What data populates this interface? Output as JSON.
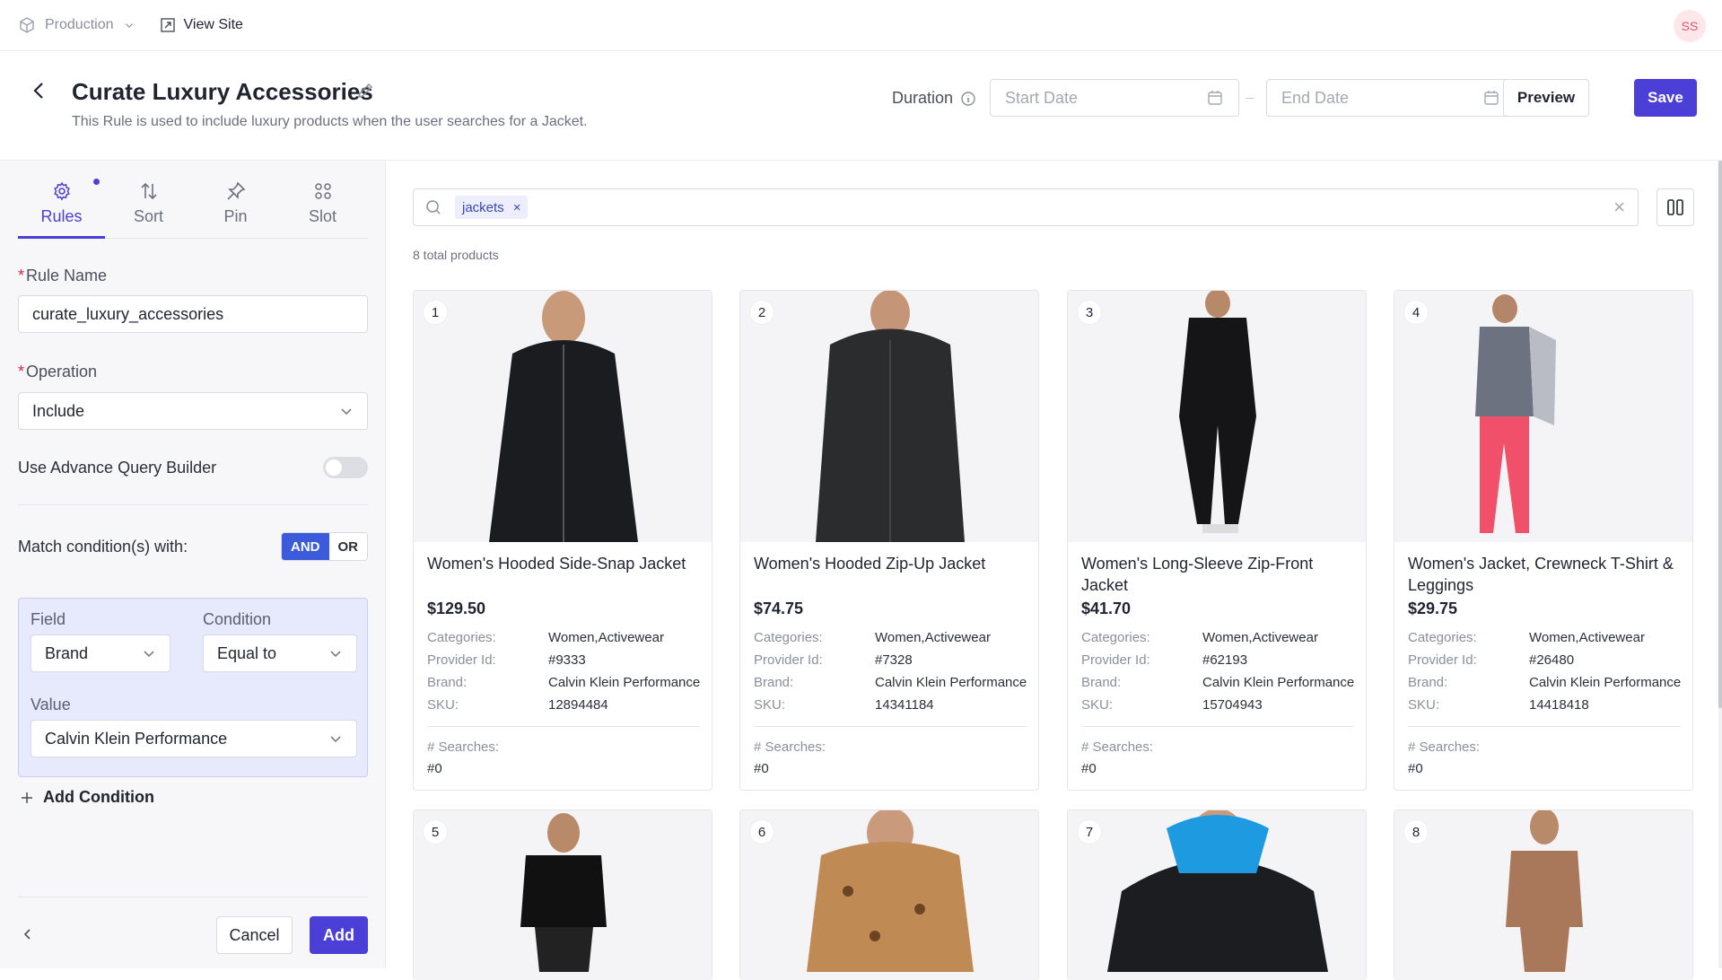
{
  "topnav": {
    "environment": "Production",
    "view_site": "View Site",
    "avatar": "SS"
  },
  "header": {
    "title": "Curate Luxury Accessories",
    "subtitle": "This Rule is used to include luxury products when the user searches for a Jacket.",
    "duration_label": "Duration",
    "start_date_placeholder": "Start Date",
    "end_date_placeholder": "End Date",
    "preview": "Preview",
    "save": "Save"
  },
  "sidebar": {
    "tabs": [
      {
        "label": "Rules",
        "icon": "gear-icon",
        "active": true
      },
      {
        "label": "Sort",
        "icon": "sort-arrows-icon",
        "active": false
      },
      {
        "label": "Pin",
        "icon": "pin-icon",
        "active": false
      },
      {
        "label": "Slot",
        "icon": "slot-grid-icon",
        "active": false
      }
    ],
    "rule_name_label": "Rule Name",
    "rule_name_value": "curate_luxury_accessories",
    "operation_label": "Operation",
    "operation_value": "Include",
    "advance_query_label": "Use Advance Query Builder",
    "advance_query_enabled": false,
    "match_label": "Match condition(s) with:",
    "match_and": "AND",
    "match_or": "OR",
    "condition": {
      "field_label": "Field",
      "field_value": "Brand",
      "condition_label": "Condition",
      "condition_value": "Equal to",
      "value_label": "Value",
      "value_value": "Calvin Klein Performance"
    },
    "add_condition": "Add Condition",
    "cancel": "Cancel",
    "add": "Add"
  },
  "main": {
    "search_chip": "jackets",
    "total": "8 total products",
    "labels": {
      "categories": "Categories:",
      "provider": "Provider Id:",
      "brand": "Brand:",
      "sku": "SKU:",
      "searches": "# Searches:"
    },
    "products": [
      {
        "num": "1",
        "name": "Women's Hooded Side-Snap Jacket",
        "price": "$129.50",
        "categories": "Women,Activewear",
        "provider": "#9333",
        "brand": "Calvin Klein Performance",
        "sku": "12894484",
        "searches": "#0"
      },
      {
        "num": "2",
        "name": "Women's Hooded Zip-Up Jacket",
        "price": "$74.75",
        "categories": "Women,Activewear",
        "provider": "#7328",
        "brand": "Calvin Klein Performance",
        "sku": "14341184",
        "searches": "#0"
      },
      {
        "num": "3",
        "name": "Women's Long-Sleeve Zip-Front Jacket",
        "price": "$41.70",
        "categories": "Women,Activewear",
        "provider": "#62193",
        "brand": "Calvin Klein Performance",
        "sku": "15704943",
        "searches": "#0"
      },
      {
        "num": "4",
        "name": "Women's Jacket, Crewneck T-Shirt & Leggings",
        "price": "$29.75",
        "categories": "Women,Activewear",
        "provider": "#26480",
        "brand": "Calvin Klein Performance",
        "sku": "14418418",
        "searches": "#0"
      }
    ],
    "more_products": [
      {
        "num": "5"
      },
      {
        "num": "6"
      },
      {
        "num": "7"
      },
      {
        "num": "8"
      }
    ]
  },
  "colors": {
    "accent": "#4b3fd8",
    "segment_on": "#3b5bdb",
    "required": "#e0233d",
    "condition_bg": "#e7e9fc"
  }
}
